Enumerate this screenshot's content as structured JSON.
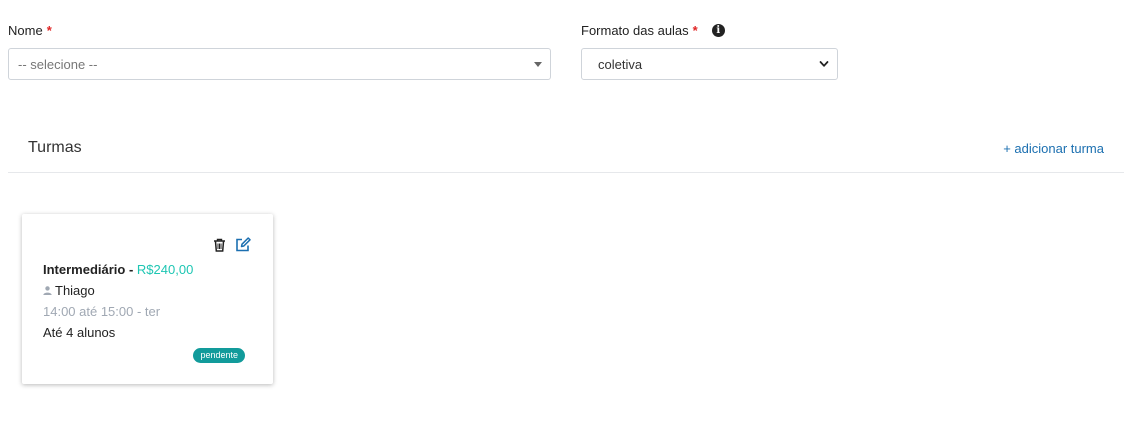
{
  "form": {
    "nome": {
      "label": "Nome",
      "required_mark": "*",
      "placeholder": "-- selecione --"
    },
    "formato": {
      "label": "Formato das aulas",
      "required_mark": "*",
      "info_glyph": "i",
      "value": "coletiva"
    }
  },
  "turmas": {
    "title": "Turmas",
    "add_label": "+ adicionar turma",
    "cards": [
      {
        "name": "Intermediário",
        "separator": " - ",
        "price": "R$240,00",
        "teacher": "Thiago",
        "schedule": "14:00 até 15:00 - ter",
        "capacity": "Até 4 alunos",
        "status": "pendente"
      }
    ]
  },
  "icons": {
    "info": "info-circle-icon",
    "delete": "trash-icon",
    "edit": "edit-icon",
    "teacher": "user-icon",
    "select_caret": "chevron-down-icon"
  },
  "colors": {
    "required": "#e02424",
    "price": "#1ec6b3",
    "link": "#1b6fb0",
    "badge": "#129b9b",
    "muted": "#a0a8b3"
  }
}
